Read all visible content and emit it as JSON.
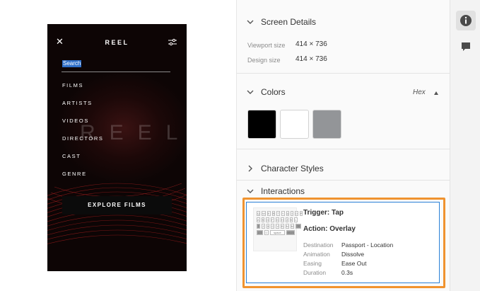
{
  "prototype": {
    "close_glyph": "✕",
    "brand": "REEL",
    "search_placeholder": "Search",
    "menu": [
      "FILMS",
      "ARTISTS",
      "VIDEOS",
      "DIRECTORS",
      "CAST",
      "GENRE"
    ],
    "ghost_text": "REEL",
    "explore_button": "EXPLORE FILMS"
  },
  "screen_details": {
    "title": "Screen Details",
    "viewport_label": "Viewport size",
    "viewport_value": "414 × 736",
    "design_label": "Design size",
    "design_value": "414 × 736"
  },
  "colors": {
    "title": "Colors",
    "format": "Hex",
    "swatches": [
      "#000000",
      "#ffffff",
      "#939598"
    ]
  },
  "character_styles": {
    "title": "Character Styles"
  },
  "interactions": {
    "title": "Interactions",
    "trigger": "Trigger: Tap",
    "action": "Action: Overlay",
    "details": [
      {
        "label": "Destination",
        "value": "Passport - Location"
      },
      {
        "label": "Animation",
        "value": "Dissolve"
      },
      {
        "label": "Easing",
        "value": "Ease Out"
      },
      {
        "label": "Duration",
        "value": "0.3s"
      }
    ],
    "keyboard_rows": [
      [
        "Q",
        "W",
        "E",
        "R",
        "T",
        "Y",
        "U",
        "I",
        "O",
        "P"
      ],
      [
        "A",
        "S",
        "D",
        "F",
        "G",
        "H",
        "J",
        "K",
        "L"
      ],
      [
        "⇧",
        "Z",
        "X",
        "C",
        "V",
        "B",
        "N",
        "M",
        "⌫"
      ],
      [
        "123",
        "☺",
        "space",
        "return"
      ]
    ]
  },
  "rail": {
    "info_icon": "info-icon",
    "comment_icon": "comment-icon"
  },
  "accent": {
    "highlight_border": "#f0932f",
    "selection_border": "#2a81d8"
  }
}
